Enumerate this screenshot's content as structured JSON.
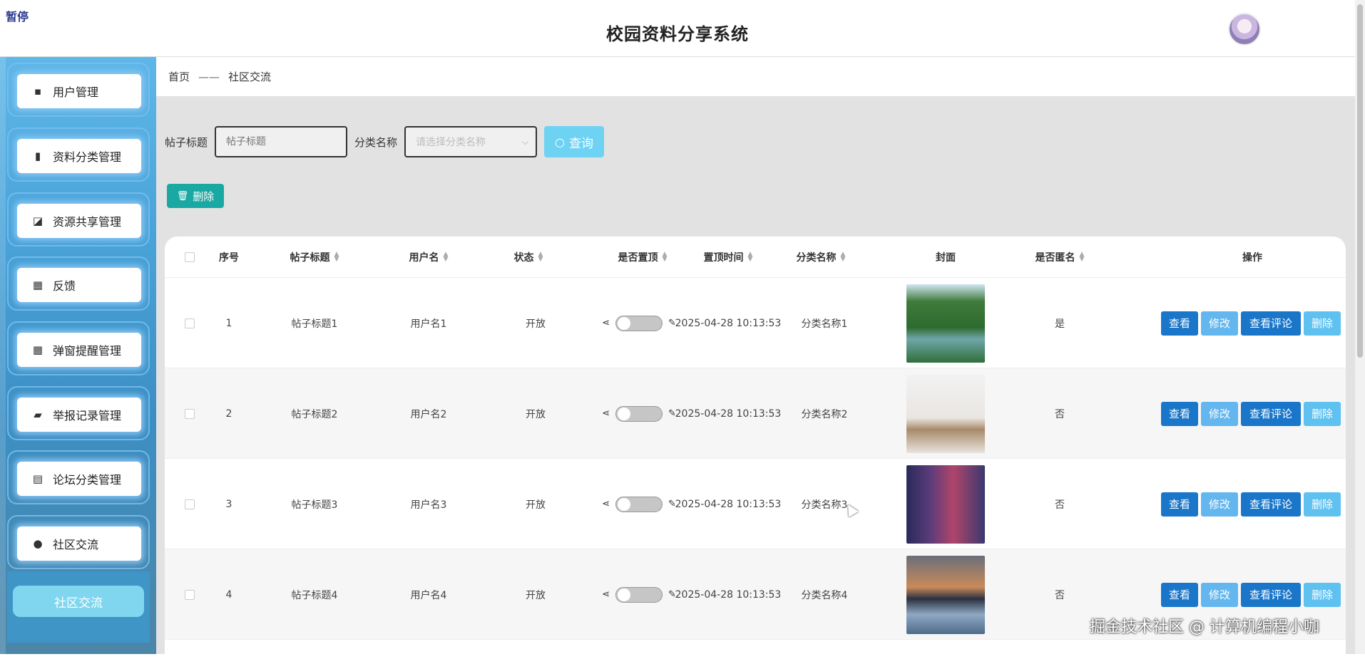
{
  "header": {
    "pause_label": "暂停",
    "title": "校园资料分享系统"
  },
  "sidebar": {
    "items": [
      {
        "label": "用户管理",
        "icon": "chat-icon"
      },
      {
        "label": "资料分类管理",
        "icon": "bar-chart-icon"
      },
      {
        "label": "资源共享管理",
        "icon": "line-chart-icon"
      },
      {
        "label": "反馈",
        "icon": "grid-icon"
      },
      {
        "label": "弹窗提醒管理",
        "icon": "grid-icon"
      },
      {
        "label": "举报记录管理",
        "icon": "wallet-icon"
      },
      {
        "label": "论坛分类管理",
        "icon": "clipboard-icon"
      },
      {
        "label": "社区交流",
        "icon": "pin-icon"
      }
    ],
    "active_sub_label": "社区交流"
  },
  "breadcrumb": {
    "home": "首页",
    "separator": "——",
    "current": "社区交流"
  },
  "search": {
    "title_label": "帖子标题",
    "title_placeholder": "帖子标题",
    "category_label": "分类名称",
    "category_placeholder": "请选择分类名称",
    "query_label": "查询"
  },
  "toolbar": {
    "delete_label": "删除"
  },
  "table": {
    "columns": [
      "序号",
      "帖子标题",
      "用户名",
      "状态",
      "是否置顶",
      "置顶时间",
      "分类名称",
      "封面",
      "是否匿名",
      "操作"
    ],
    "rows": [
      {
        "index": "1",
        "title": "帖子标题1",
        "user": "用户名1",
        "status": "开放",
        "pinned": false,
        "pin_time": "2025-04-28 10:13:53",
        "category": "分类名称1",
        "cover": "forest-river",
        "anonymous": "是"
      },
      {
        "index": "2",
        "title": "帖子标题2",
        "user": "用户名2",
        "status": "开放",
        "pinned": false,
        "pin_time": "2025-04-28 10:13:53",
        "category": "分类名称2",
        "cover": "coffee-book",
        "anonymous": "否"
      },
      {
        "index": "3",
        "title": "帖子标题3",
        "user": "用户名3",
        "status": "开放",
        "pinned": false,
        "pin_time": "2025-04-28 10:13:53",
        "category": "分类名称3",
        "cover": "heroes-poster",
        "anonymous": "否"
      },
      {
        "index": "4",
        "title": "帖子标题4",
        "user": "用户名4",
        "status": "开放",
        "pinned": false,
        "pin_time": "2025-04-28 10:13:53",
        "category": "分类名称4",
        "cover": "lake-sunset",
        "anonymous": "否"
      }
    ],
    "actions": {
      "view": "查看",
      "edit": "修改",
      "comments": "查看评论",
      "delete": "删除"
    }
  },
  "watermark": "掘金技术社区 @ 计算机编程小咖",
  "colors": {
    "primary": "#1976c9",
    "light": "#64b6ef",
    "teal": "#1aa8a3",
    "query": "#6ed2f3",
    "sidebar": "#4aa3d8"
  }
}
